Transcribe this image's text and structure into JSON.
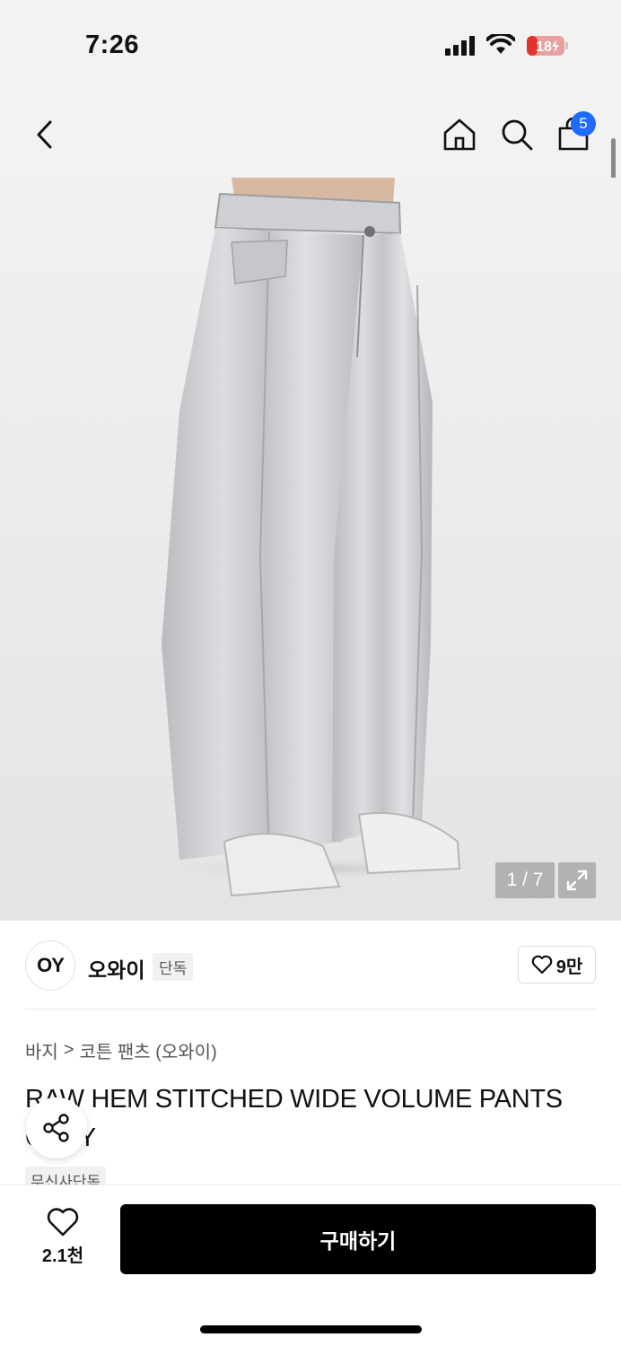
{
  "status_bar": {
    "time": "7:26",
    "battery": "18"
  },
  "nav": {
    "cart_count": "5"
  },
  "gallery": {
    "page_counter": "1 / 7"
  },
  "brand": {
    "logo_text": "OY",
    "name": "오와이",
    "exclusive_badge": "단독",
    "like_count": "9만"
  },
  "breadcrumb": {
    "category": "바지",
    "separator": ">",
    "subcategory": "코튼 팬츠 (오와이)"
  },
  "product": {
    "title": "RAW HEM STITCHED WIDE VOLUME PANTS GRAY",
    "tag": "무신사단독"
  },
  "bottom_bar": {
    "wish_count": "2.1천",
    "buy_label": "구매하기"
  },
  "colors": {
    "accent_badge": "#1f6bff",
    "buy_button": "#000000"
  },
  "icons": [
    "back-icon",
    "home-icon",
    "search-icon",
    "cart-icon",
    "heart-icon",
    "share-icon",
    "expand-icon",
    "chevron-right-icon"
  ]
}
